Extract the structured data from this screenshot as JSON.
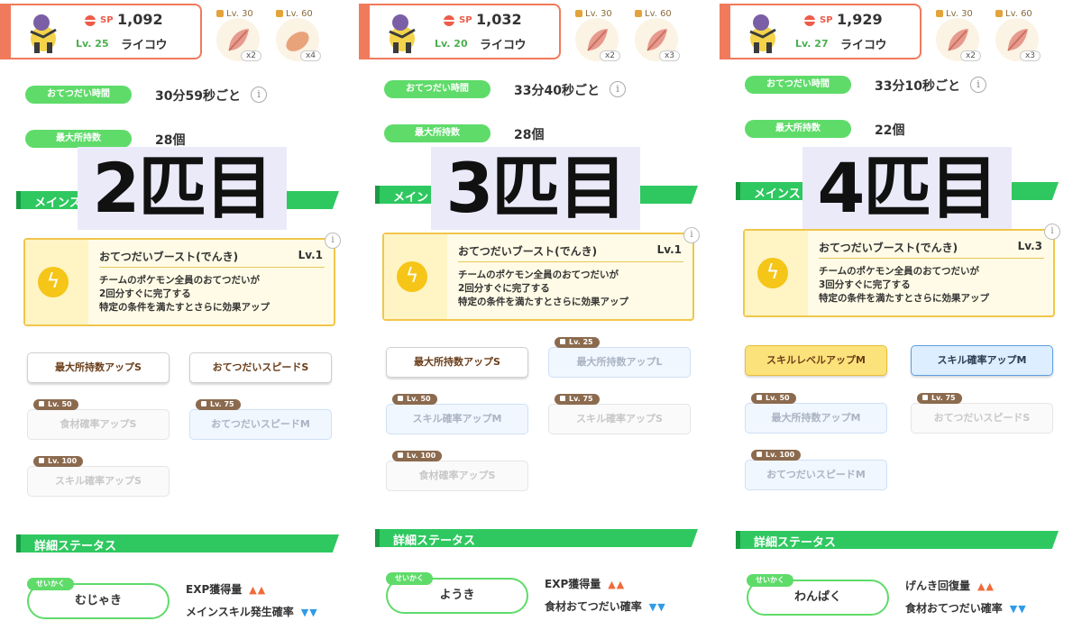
{
  "panels": [
    {
      "sp_label": "SP",
      "sp_value": "1,092",
      "level": "Lv. 25",
      "name": "ライコウ",
      "ingredients": [
        {
          "lv": "Lv. 30",
          "qty": "x2"
        },
        {
          "lv": "Lv. 60",
          "qty": "x4"
        }
      ],
      "help_time_label": "おてつだい時間",
      "help_time_value": "30分59秒ごと",
      "max_carry_label": "最大所持数",
      "max_carry_value": "28個",
      "overlay": "2匹目",
      "main_skill_title": "メインス",
      "skill": {
        "name": "おてつだいブースト(でんき)",
        "level": "Lv.1",
        "desc1": "チームのポケモン全員のおてつだいが",
        "desc2": "2回分すぐに完了する",
        "desc3": "特定の条件を満たすとさらに効果アップ"
      },
      "subskills": [
        {
          "label": "最大所持数アップS",
          "lv": "",
          "style": "active"
        },
        {
          "label": "おてつだいスピードS",
          "lv": "",
          "style": "active"
        },
        {
          "label": "食材確率アップS",
          "lv": "Lv. 50",
          "style": "locked"
        },
        {
          "label": "おてつだいスピードM",
          "lv": "Lv. 75",
          "style": "locked-blue"
        },
        {
          "label": "スキル確率アップS",
          "lv": "Lv. 100",
          "style": "locked"
        }
      ],
      "detail_title": "詳細ステータス",
      "nature_tag": "せいかく",
      "nature": "むじゃき",
      "nature_up": "EXP獲得量",
      "nature_down": "メインスキル発生確率"
    },
    {
      "sp_label": "SP",
      "sp_value": "1,032",
      "level": "Lv. 20",
      "name": "ライコウ",
      "ingredients": [
        {
          "lv": "Lv. 30",
          "qty": "x2"
        },
        {
          "lv": "Lv. 60",
          "qty": "x3"
        }
      ],
      "help_time_label": "おてつだい時間",
      "help_time_value": "33分40秒ごと",
      "max_carry_label": "最大所持数",
      "max_carry_value": "28個",
      "overlay": "3匹目",
      "main_skill_title": "メイン",
      "skill": {
        "name": "おてつだいブースト(でんき)",
        "level": "Lv.1",
        "desc1": "チームのポケモン全員のおてつだいが",
        "desc2": "2回分すぐに完了する",
        "desc3": "特定の条件を満たすとさらに効果アップ"
      },
      "subskills": [
        {
          "label": "最大所持数アップS",
          "lv": "",
          "style": "active"
        },
        {
          "label": "最大所持数アップL",
          "lv": "Lv. 25",
          "style": "locked-blue"
        },
        {
          "label": "スキル確率アップM",
          "lv": "Lv. 50",
          "style": "locked-blue"
        },
        {
          "label": "スキル確率アップS",
          "lv": "Lv. 75",
          "style": "locked"
        },
        {
          "label": "食材確率アップS",
          "lv": "Lv. 100",
          "style": "locked"
        }
      ],
      "detail_title": "詳細ステータス",
      "nature_tag": "せいかく",
      "nature": "ようき",
      "nature_up": "EXP獲得量",
      "nature_down": "食材おてつだい確率"
    },
    {
      "sp_label": "SP",
      "sp_value": "1,929",
      "level": "Lv. 27",
      "name": "ライコウ",
      "ingredients": [
        {
          "lv": "Lv. 30",
          "qty": "x2"
        },
        {
          "lv": "Lv. 60",
          "qty": "x3"
        }
      ],
      "help_time_label": "おてつだい時間",
      "help_time_value": "33分10秒ごと",
      "max_carry_label": "最大所持数",
      "max_carry_value": "22個",
      "overlay": "4匹目",
      "main_skill_title": "メインス",
      "skill": {
        "name": "おてつだいブースト(でんき)",
        "level": "Lv.3",
        "desc1": "チームのポケモン全員のおてつだいが",
        "desc2": "3回分すぐに完了する",
        "desc3": "特定の条件を満たすとさらに効果アップ"
      },
      "subskills": [
        {
          "label": "スキルレベルアップM",
          "lv": "",
          "style": "gold"
        },
        {
          "label": "スキル確率アップM",
          "lv": "",
          "style": "blue"
        },
        {
          "label": "最大所持数アップM",
          "lv": "Lv. 50",
          "style": "locked-blue"
        },
        {
          "label": "おてつだいスピードS",
          "lv": "Lv. 75",
          "style": "locked"
        },
        {
          "label": "おてつだいスピードM",
          "lv": "Lv. 100",
          "style": "locked-blue"
        }
      ],
      "detail_title": "詳細ステータス",
      "nature_tag": "せいかく",
      "nature": "わんぱく",
      "nature_up": "げんき回復量",
      "nature_down": "食材おてつだい確率"
    }
  ],
  "icons": {
    "info": "i",
    "bolt": "ϟ",
    "up_arrows": "▲▲",
    "down_arrows": "▼▼"
  },
  "colors": {
    "accent_green": "#5fdb6a",
    "card_border": "#f07a5c",
    "skill_yellow": "#f5c518"
  }
}
